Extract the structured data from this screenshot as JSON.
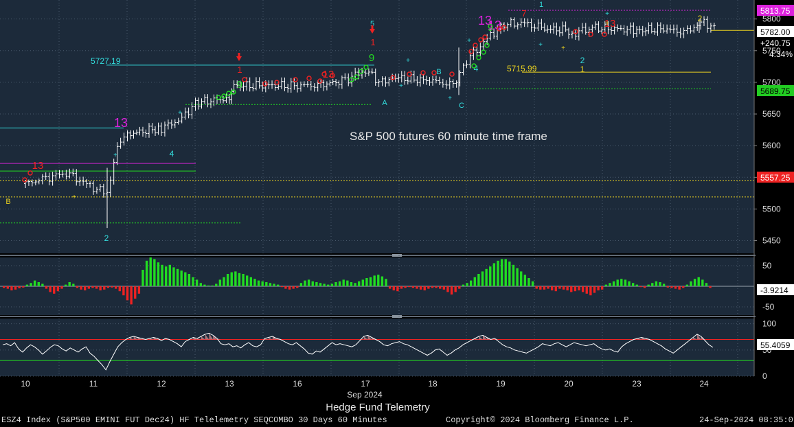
{
  "footer": {
    "security": "ESZ4 Index (S&P500 EMINI FUT  Dec24) HF Telelemetry SEQCOMBO 30 Days 60 Minutes",
    "copyright": "Copyright© 2024 Bloomberg Finance L.P.",
    "timestamp": "24-Sep-2024 08:35:07"
  },
  "colors": {
    "background": "#1c2a3a",
    "buy_setup": "#22dd22",
    "sell_setup": "#ee2222",
    "countdown": "#dd22dd",
    "cyan": "#33dddd",
    "yellow": "#e8d020",
    "price_line": "#ffffff"
  },
  "chart_data": [
    {
      "type": "candlestick",
      "title": "Hedge Fund Telemetry",
      "annotation": "S&P 500 futures 60 minute time frame",
      "x_month": "Sep 2024",
      "x_ticks": [
        "10",
        "11",
        "12",
        "13",
        "16",
        "17",
        "18",
        "19",
        "20",
        "23",
        "24"
      ],
      "y_ticks": [
        5450,
        5500,
        5550,
        5600,
        5650,
        5700,
        5750,
        5800
      ],
      "ylim": [
        5430,
        5830
      ],
      "grid": true,
      "last_price_label": "5782.00",
      "change_label": "+240.75",
      "change_pct_label": "4.34%",
      "price_tags": [
        {
          "label": "5813.75",
          "value": 5813.75,
          "color": "#dd22dd"
        },
        {
          "label": "5689.75",
          "value": 5689.75,
          "color": "#22cc22"
        },
        {
          "label": "5557.25",
          "value": 5557.25,
          "color": "#ee2222"
        }
      ],
      "price_path": [
        {
          "x": 10.0,
          "y": 5540
        },
        {
          "x": 10.3,
          "y": 5548
        },
        {
          "x": 10.6,
          "y": 5558
        },
        {
          "x": 10.9,
          "y": 5538
        },
        {
          "x": 11.2,
          "y": 5525
        },
        {
          "x": 11.35,
          "y": 5598
        },
        {
          "x": 11.5,
          "y": 5618
        },
        {
          "x": 12.0,
          "y": 5628
        },
        {
          "x": 12.3,
          "y": 5642
        },
        {
          "x": 12.5,
          "y": 5668
        },
        {
          "x": 13.0,
          "y": 5675
        },
        {
          "x": 13.2,
          "y": 5695
        },
        {
          "x": 16.0,
          "y": 5695
        },
        {
          "x": 16.3,
          "y": 5695
        },
        {
          "x": 16.7,
          "y": 5703
        },
        {
          "x": 17.0,
          "y": 5720
        },
        {
          "x": 17.2,
          "y": 5700
        },
        {
          "x": 17.4,
          "y": 5708
        },
        {
          "x": 18.0,
          "y": 5702
        },
        {
          "x": 18.3,
          "y": 5695
        },
        {
          "x": 18.5,
          "y": 5735
        },
        {
          "x": 18.8,
          "y": 5768
        },
        {
          "x": 19.0,
          "y": 5790
        },
        {
          "x": 19.3,
          "y": 5795
        },
        {
          "x": 19.6,
          "y": 5785
        },
        {
          "x": 20.0,
          "y": 5782
        },
        {
          "x": 20.3,
          "y": 5770
        },
        {
          "x": 20.6,
          "y": 5783
        },
        {
          "x": 20.9,
          "y": 5787
        },
        {
          "x": 23.0,
          "y": 5782
        },
        {
          "x": 23.4,
          "y": 5785
        },
        {
          "x": 23.7,
          "y": 5779
        },
        {
          "x": 24.0,
          "y": 5795
        },
        {
          "x": 24.2,
          "y": 5782
        }
      ],
      "levels": [
        {
          "label": "5727.19",
          "value": 5727.19,
          "color": "#33dddd"
        },
        {
          "label": "5715.99",
          "value": 5715.99,
          "color": "#e8d020"
        }
      ],
      "setup_labels": [
        {
          "text": "13",
          "color": "#dd22dd"
        },
        {
          "text": "13",
          "color": "#dd22dd"
        },
        {
          "text": "13",
          "color": "#dd22dd"
        },
        {
          "text": "9",
          "color": "#22dd22"
        },
        {
          "text": "9",
          "color": "#22dd22"
        },
        {
          "text": "9",
          "color": "#22dd22"
        },
        {
          "text": "13",
          "color": "#ee2222"
        },
        {
          "text": "13",
          "color": "#ee2222"
        },
        {
          "text": "13",
          "color": "#ee2222"
        },
        {
          "text": "1",
          "color": "#ee2222"
        },
        {
          "text": "1",
          "color": "#ee2222"
        },
        {
          "text": "7",
          "color": "#ee2222"
        },
        {
          "text": "5",
          "color": "#33dddd"
        },
        {
          "text": "1",
          "color": "#33dddd"
        },
        {
          "text": "2",
          "color": "#33dddd"
        },
        {
          "text": "2",
          "color": "#33dddd"
        },
        {
          "text": "4",
          "color": "#33dddd"
        },
        {
          "text": "4",
          "color": "#33dddd"
        },
        {
          "text": "1",
          "color": "#e8d020"
        },
        {
          "text": "2",
          "color": "#e8d020"
        },
        {
          "text": "A",
          "color": "#33dddd"
        },
        {
          "text": "B",
          "color": "#33dddd"
        },
        {
          "text": "C",
          "color": "#33dddd"
        },
        {
          "text": "B",
          "color": "#e8d020"
        }
      ]
    },
    {
      "type": "bar",
      "ylim": [
        -70,
        70
      ],
      "y_ticks": [
        50,
        -50
      ],
      "last_value_label": "-3.9214",
      "values": [
        -4,
        -6,
        -10,
        -8,
        -5,
        -3,
        4,
        8,
        14,
        10,
        6,
        -6,
        -14,
        -18,
        -12,
        -6,
        4,
        10,
        6,
        -4,
        -8,
        -10,
        -6,
        -4,
        -6,
        -10,
        -8,
        -4,
        -3,
        -6,
        -12,
        -22,
        -34,
        -44,
        -30,
        -18,
        40,
        62,
        70,
        66,
        58,
        52,
        48,
        52,
        46,
        42,
        38,
        34,
        30,
        22,
        16,
        8,
        4,
        2,
        2,
        6,
        16,
        22,
        30,
        34,
        36,
        32,
        30,
        26,
        22,
        18,
        14,
        12,
        10,
        8,
        6,
        4,
        -2,
        -6,
        -8,
        -6,
        -4,
        8,
        14,
        16,
        12,
        10,
        8,
        6,
        4,
        6,
        10,
        12,
        16,
        14,
        10,
        8,
        12,
        16,
        20,
        22,
        26,
        28,
        24,
        18,
        -6,
        -10,
        -12,
        -6,
        -4,
        -2,
        -4,
        -6,
        -8,
        -10,
        -6,
        -4,
        -4,
        -6,
        -8,
        -14,
        -20,
        -14,
        -6,
        4,
        8,
        14,
        22,
        30,
        36,
        42,
        48,
        56,
        62,
        66,
        66,
        60,
        52,
        44,
        36,
        28,
        20,
        12,
        -6,
        -8,
        -8,
        -6,
        -10,
        -12,
        -6,
        -8,
        -10,
        -14,
        -12,
        -10,
        -14,
        -18,
        -22,
        -16,
        -10,
        -8,
        4,
        8,
        12,
        16,
        18,
        16,
        12,
        8,
        4,
        -2,
        -4,
        4,
        8,
        12,
        10,
        6,
        -3,
        -4,
        -6,
        -8,
        -4,
        4,
        12,
        18,
        22,
        16,
        8,
        -4
      ]
    },
    {
      "type": "line",
      "ylim": [
        0,
        110
      ],
      "y_ticks": [
        100,
        50,
        0
      ],
      "last_value_label": "55.4059",
      "thresholds": [
        70,
        30
      ],
      "values": [
        60,
        62,
        58,
        64,
        52,
        46,
        54,
        60,
        56,
        50,
        42,
        48,
        55,
        60,
        58,
        52,
        48,
        54,
        50,
        46,
        52,
        56,
        44,
        38,
        30,
        22,
        12,
        28,
        42,
        56,
        64,
        70,
        74,
        76,
        74,
        72,
        70,
        72,
        74,
        72,
        68,
        72,
        70,
        66,
        62,
        56,
        66,
        70,
        74,
        72,
        76,
        80,
        82,
        78,
        72,
        62,
        60,
        62,
        56,
        58,
        54,
        60,
        64,
        58,
        56,
        60,
        72,
        74,
        76,
        72,
        70,
        66,
        62,
        60,
        64,
        58,
        52,
        44,
        42,
        48,
        46,
        52,
        58,
        64,
        60,
        62,
        60,
        58,
        56,
        60,
        68,
        76,
        78,
        74,
        70,
        66,
        60,
        58,
        62,
        64,
        66,
        62,
        60,
        56,
        52,
        48,
        44,
        40,
        44,
        50,
        52,
        46,
        40,
        44,
        50,
        54,
        60,
        64,
        68,
        72,
        76,
        78,
        74,
        70,
        72,
        66,
        60,
        56,
        54,
        50,
        48,
        46,
        44,
        48,
        52,
        56,
        62,
        60,
        58,
        62,
        64,
        60,
        56,
        60,
        64,
        62,
        60,
        58,
        60,
        62,
        56,
        52,
        50,
        52,
        48,
        46,
        56,
        62,
        66,
        70,
        72,
        74,
        72,
        70,
        66,
        62,
        58,
        52,
        48,
        44,
        50,
        56,
        62,
        68,
        74,
        80,
        76,
        68,
        60,
        55
      ]
    }
  ]
}
